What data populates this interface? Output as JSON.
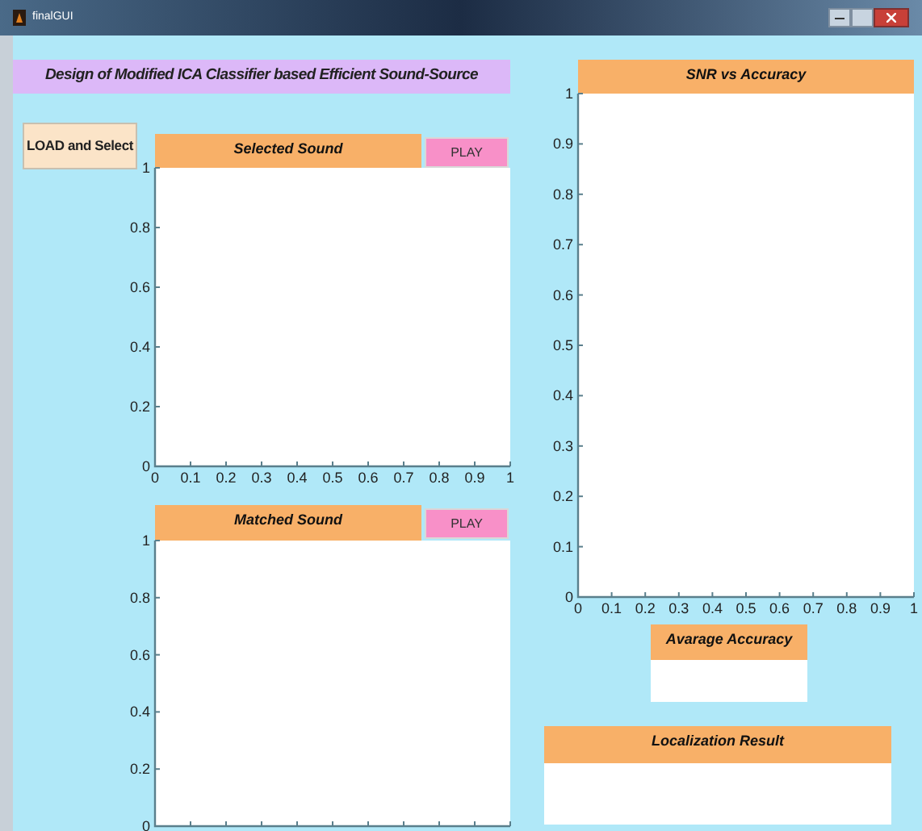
{
  "window": {
    "title": "finalGUI"
  },
  "banner": {
    "title": "Design of Modified ICA Classifier based Efficient Sound-Source"
  },
  "load_button": {
    "label": "LOAD and Select"
  },
  "selected_sound": {
    "title": "Selected Sound",
    "play_label": "PLAY",
    "chart_data": {
      "type": "line",
      "xlim": [
        0,
        1
      ],
      "ylim": [
        0,
        1
      ],
      "xticks": [
        0,
        0.1,
        0.2,
        0.3,
        0.4,
        0.5,
        0.6,
        0.7,
        0.8,
        0.9,
        1
      ],
      "yticks": [
        0,
        0.2,
        0.4,
        0.6,
        0.8,
        1
      ]
    }
  },
  "matched_sound": {
    "title": "Matched Sound",
    "play_label": "PLAY",
    "chart_data": {
      "type": "line",
      "categories": [
        null,
        null,
        null,
        null,
        null,
        null,
        null,
        null,
        null,
        null,
        null
      ],
      "ylim": [
        0,
        1
      ],
      "yticks": [
        0,
        0.2,
        0.4,
        0.6,
        0.8,
        1
      ]
    }
  },
  "snr_chart": {
    "title": "SNR vs Accuracy",
    "chart_data": {
      "type": "line",
      "xlim": [
        0,
        1
      ],
      "ylim": [
        0,
        1
      ],
      "xticks": [
        0,
        0.1,
        0.2,
        0.3,
        0.4,
        0.5,
        0.6,
        0.7,
        0.8,
        0.9,
        1
      ],
      "yticks": [
        0,
        0.1,
        0.2,
        0.3,
        0.4,
        0.5,
        0.6,
        0.7,
        0.8,
        0.9,
        1
      ]
    }
  },
  "average_accuracy": {
    "title": "Avarage Accuracy"
  },
  "localization_result": {
    "title": "Localization Result"
  }
}
